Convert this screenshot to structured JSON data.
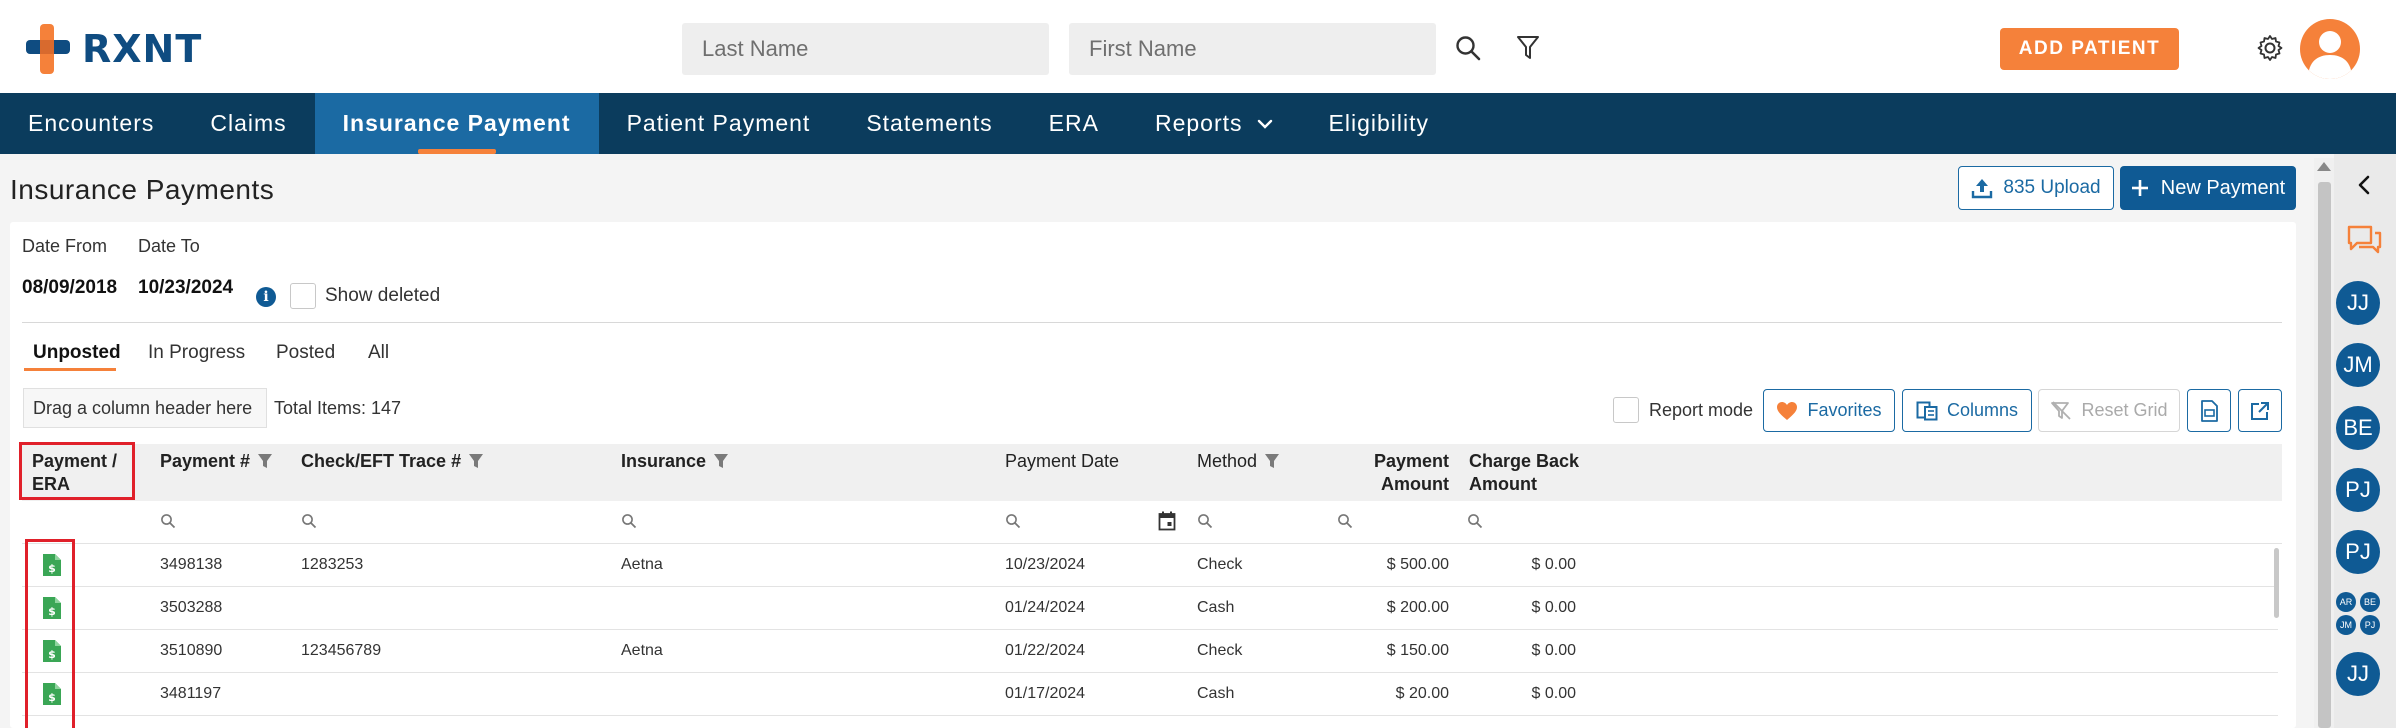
{
  "header": {
    "brand": "RXNT",
    "last_name_placeholder": "Last Name",
    "first_name_placeholder": "First Name",
    "add_patient_label": "ADD PATIENT",
    "icons": [
      "search-icon",
      "filter-icon",
      "gear-icon",
      "user-avatar-icon"
    ]
  },
  "nav": {
    "items": [
      {
        "label": "Encounters"
      },
      {
        "label": "Claims"
      },
      {
        "label": "Insurance Payment",
        "active": true
      },
      {
        "label": "Patient Payment"
      },
      {
        "label": "Statements"
      },
      {
        "label": "ERA"
      },
      {
        "label": "Reports",
        "has_dropdown": true
      },
      {
        "label": "Eligibility"
      }
    ]
  },
  "page": {
    "title": "Insurance Payments",
    "upload_label": "835 Upload",
    "new_payment_label": "New Payment",
    "date_from_label": "Date From",
    "date_to_label": "Date To",
    "date_from": "08/09/2018",
    "date_to": "10/23/2024",
    "show_deleted_label": "Show deleted",
    "tabs": [
      {
        "label": "Unposted",
        "active": true
      },
      {
        "label": "In Progress"
      },
      {
        "label": "Posted"
      },
      {
        "label": "All"
      }
    ],
    "group_hint": "Drag a column header here",
    "total_items": "Total Items: 147",
    "report_mode_label": "Report mode",
    "favorites_label": "Favorites",
    "columns_label": "Columns",
    "reset_grid_label": "Reset Grid"
  },
  "grid": {
    "columns": {
      "payment_era_1": "Payment /",
      "payment_era_2": "ERA",
      "payment_no": "Payment #",
      "check_trace": "Check/EFT Trace #",
      "insurance": "Insurance",
      "payment_date": "Payment Date",
      "method": "Method",
      "payment_amount_1": "Payment",
      "payment_amount_2": "Amount",
      "charge_back_1": "Charge Back",
      "charge_back_2": "Amount"
    },
    "rows": [
      {
        "payment_no": "3498138",
        "trace": "1283253",
        "insurance": "Aetna",
        "date": "10/23/2024",
        "method": "Check",
        "amount": "$ 500.00",
        "charge_back": "$ 0.00"
      },
      {
        "payment_no": "3503288",
        "trace": "",
        "insurance": "",
        "date": "01/24/2024",
        "method": "Cash",
        "amount": "$ 200.00",
        "charge_back": "$ 0.00"
      },
      {
        "payment_no": "3510890",
        "trace": "123456789",
        "insurance": "Aetna",
        "date": "01/22/2024",
        "method": "Check",
        "amount": "$ 150.00",
        "charge_back": "$ 0.00"
      },
      {
        "payment_no": "3481197",
        "trace": "",
        "insurance": "",
        "date": "01/17/2024",
        "method": "Cash",
        "amount": "$ 20.00",
        "charge_back": "$ 0.00"
      }
    ]
  },
  "rail": {
    "avatars": [
      "JJ",
      "JM",
      "BE",
      "PJ",
      "PJ"
    ],
    "mini_avatars": [
      "AR",
      "BE",
      "JM",
      "PJ"
    ],
    "last_avatar": "JJ"
  },
  "colors": {
    "brand_blue": "#0b3c5d",
    "active_tab": "#1b6aa3",
    "accent_orange": "#f5813a",
    "highlight_red": "#e0202a",
    "era_green": "#3aa655"
  }
}
